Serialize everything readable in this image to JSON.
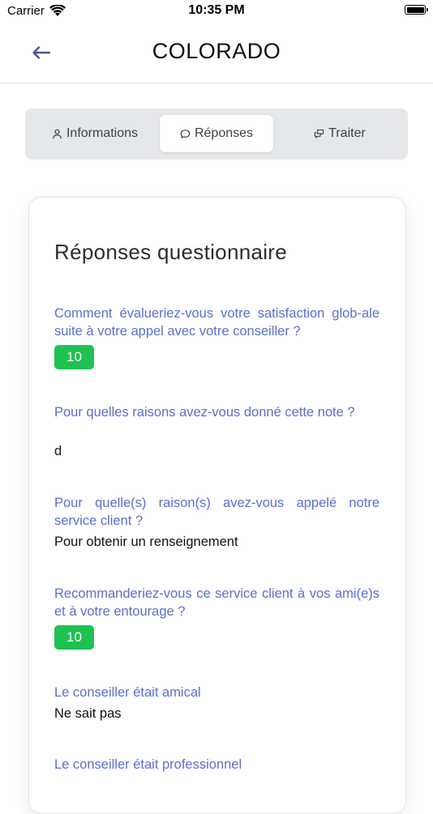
{
  "status_bar": {
    "carrier": "Carrier",
    "time": "10:35 PM"
  },
  "nav": {
    "title": "COLORADO"
  },
  "tabs": [
    {
      "label": "Informations",
      "icon": "user-icon"
    },
    {
      "label": "Réponses",
      "icon": "chat-bubble-icon",
      "active": true
    },
    {
      "label": "Traiter",
      "icon": "conversation-icon"
    }
  ],
  "card": {
    "title": "Réponses questionnaire",
    "questions": [
      {
        "question": "Comment évalueriez-vous votre satisfaction glob-ale suite à votre appel avec votre conseiller ?",
        "answer": "10",
        "answer_type": "badge"
      },
      {
        "question": "Pour quelles raisons avez-vous donné cette note ?",
        "answer": "d",
        "answer_type": "text"
      },
      {
        "question": "Pour quelle(s) raison(s) avez-vous appelé notre service client ?",
        "answer": "Pour obtenir un renseignement",
        "answer_type": "text"
      },
      {
        "question": "Recommanderiez-vous ce service client à vos ami(e)s et à votre entourage ?",
        "answer": "10",
        "answer_type": "badge"
      },
      {
        "question": "Le conseiller était amical",
        "answer": "Ne sait pas",
        "answer_type": "text"
      },
      {
        "question": "Le conseiller était professionnel",
        "answer": "",
        "answer_type": "text"
      }
    ]
  },
  "colors": {
    "accent_text": "#5a6fd0",
    "badge_green": "#1fc150",
    "segment_bg": "#e5e8eb"
  }
}
